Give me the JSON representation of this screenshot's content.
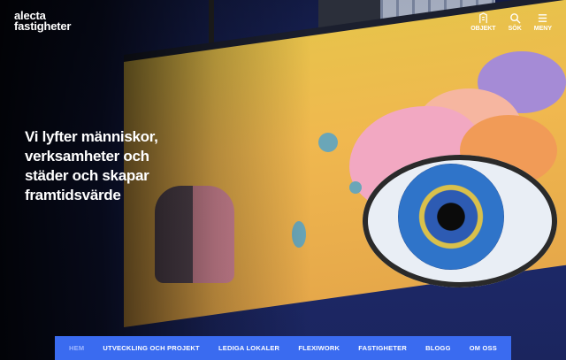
{
  "brand": {
    "line1": "alecta",
    "line2": "fastigheter"
  },
  "header_nav": [
    {
      "label": "OBJEKT",
      "icon": "building-icon"
    },
    {
      "label": "SÖK",
      "icon": "search-icon"
    },
    {
      "label": "MENY",
      "icon": "menu-icon"
    }
  ],
  "hero": {
    "headline": "Vi lyfter människor, verksamheter och städer och skapar framtidsvärde"
  },
  "bottom_nav": {
    "items": [
      {
        "label": "HEM",
        "active": true
      },
      {
        "label": "UTVECKLING OCH PROJEKT"
      },
      {
        "label": "LEDIGA LOKALER"
      },
      {
        "label": "FLEXIWORK"
      },
      {
        "label": "FASTIGHETER"
      },
      {
        "label": "BLOGG"
      },
      {
        "label": "OM OSS"
      }
    ],
    "color": "#3a6bf0"
  }
}
